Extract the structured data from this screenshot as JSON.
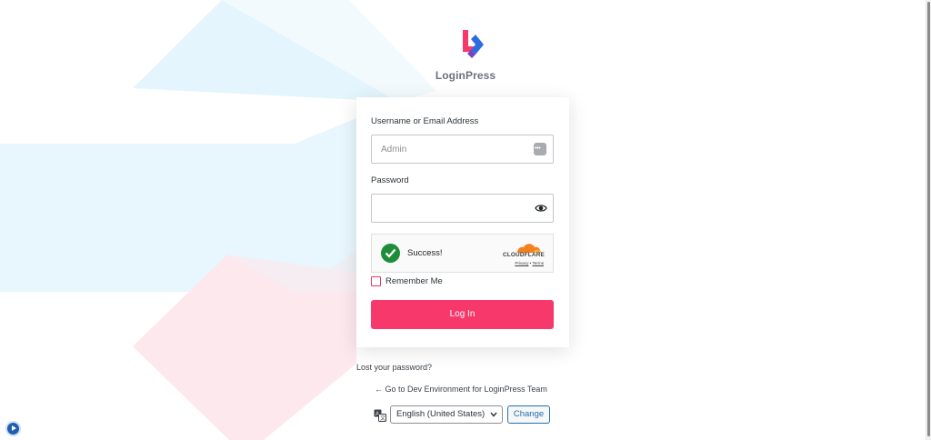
{
  "brand": {
    "name": "LoginPress"
  },
  "form": {
    "username_label": "Username or Email Address",
    "username_value": "Admin",
    "password_label": "Password",
    "password_value": "",
    "remember_label": "Remember Me",
    "login_label": "Log In"
  },
  "captcha": {
    "status_text": "Success!",
    "provider": "CLOUDFLARE",
    "privacy_label": "Privacy",
    "separator": "•",
    "terms_label": "Terms"
  },
  "links": {
    "lost_password": "Lost your password?",
    "back_to_site": "← Go to Dev Environment for LoginPress Team"
  },
  "language": {
    "selected": "English (United States)",
    "change_label": "Change"
  },
  "colors": {
    "accent": "#f7386a",
    "success": "#1e8d3a",
    "link_blue": "#2271b1"
  }
}
